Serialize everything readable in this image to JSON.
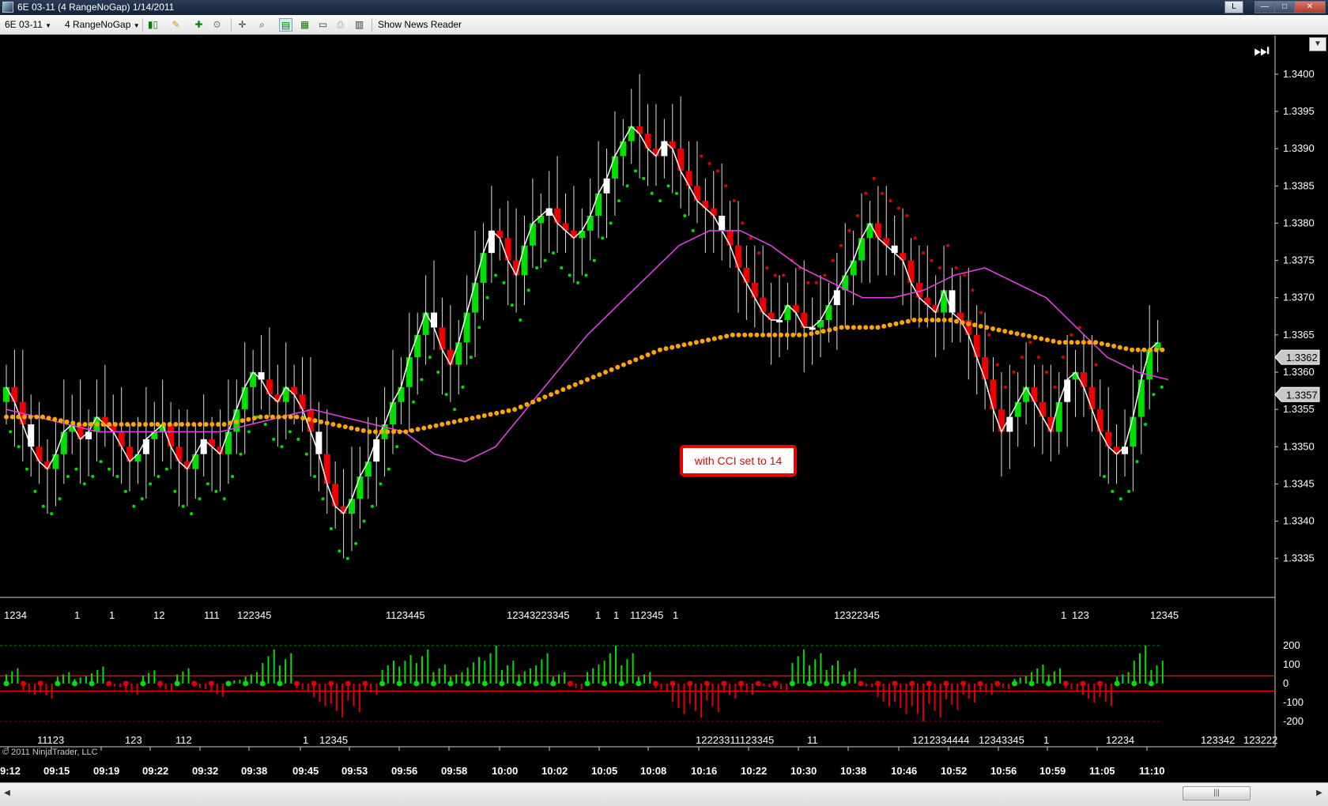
{
  "window": {
    "title": "6E 03-11 (4 RangeNoGap)  1/14/2011",
    "buttons": {
      "l": "L",
      "minimize": "—",
      "maximize": "□",
      "close": "✕"
    }
  },
  "toolbar": {
    "instrument": "6E 03-11",
    "period": "4 RangeNoGap",
    "show_news_reader": "Show News Reader",
    "icons": [
      "bar-type-icon",
      "pencil-draw-icon",
      "add-indicator-icon",
      "strategy-icon",
      "crosshair-icon",
      "zoom-icon",
      "chart-style-icon",
      "properties-icon",
      "data-box-icon",
      "print-icon",
      "instrument-icon"
    ]
  },
  "chart": {
    "annotation": "with CCI set to 14",
    "copyright": "© 2011 NinjaTrader, LLC",
    "current_price_label": "1.3362",
    "secondary_price_label": "1.3357",
    "price_axis": [
      "1.3400",
      "1.3395",
      "1.3390",
      "1.3385",
      "1.3380",
      "1.3375",
      "1.3370",
      "1.3365",
      "1.3360",
      "1.3355",
      "1.3350",
      "1.3345",
      "1.3340",
      "1.3335"
    ],
    "cci_axis": [
      "200",
      "100",
      "0",
      "-100",
      "-200"
    ],
    "time_axis": [
      "9:12",
      "09:15",
      "09:19",
      "09:22",
      "09:32",
      "09:38",
      "09:45",
      "09:53",
      "09:56",
      "09:58",
      "10:00",
      "10:02",
      "10:05",
      "10:08",
      "10:16",
      "10:22",
      "10:30",
      "10:38",
      "10:46",
      "10:52",
      "10:56",
      "10:59",
      "11:05",
      "11:10"
    ],
    "top_count_labels": [
      "1234",
      "1",
      "1",
      "12",
      "111",
      "122345",
      "1123445",
      "12343223345",
      "1",
      "1",
      "112345",
      "1",
      "12322345",
      "1",
      "123",
      "12345"
    ],
    "bottom_count_labels": [
      "11123",
      "123",
      "112",
      "1",
      "12345",
      "12223311123345",
      "11",
      "1212334444",
      "12343345",
      "1",
      "12234",
      "123342",
      "123222"
    ],
    "colors": {
      "up": "#00e000",
      "down": "#ee0000",
      "neutral": "#ffffff",
      "sma": "#e040e0",
      "ema": "#ffa500",
      "price_line": "#ffffff",
      "grid_line": "#ff0000"
    }
  },
  "chart_data": {
    "type": "candlestick",
    "title": "",
    "instrument": "6E 03-11",
    "bar_type": "4 RangeNoGap",
    "ylim": [
      1.3332,
      1.3402
    ],
    "cci_ylim": [
      -250,
      250
    ],
    "close_series": [
      1.3358,
      1.3356,
      1.3353,
      1.335,
      1.3348,
      1.3347,
      1.3349,
      1.3352,
      1.3353,
      1.3351,
      1.3352,
      1.3354,
      1.3353,
      1.3352,
      1.335,
      1.3348,
      1.3349,
      1.3351,
      1.3352,
      1.3353,
      1.335,
      1.3348,
      1.3347,
      1.3349,
      1.3351,
      1.335,
      1.3349,
      1.3352,
      1.3355,
      1.3358,
      1.336,
      1.3359,
      1.3357,
      1.3356,
      1.3358,
      1.3357,
      1.3355,
      1.3352,
      1.3349,
      1.3345,
      1.3342,
      1.3341,
      1.3343,
      1.3346,
      1.3348,
      1.3351,
      1.3353,
      1.3356,
      1.3358,
      1.3362,
      1.3365,
      1.3368,
      1.3366,
      1.3363,
      1.3361,
      1.3364,
      1.3368,
      1.3372,
      1.3376,
      1.3379,
      1.3378,
      1.3375,
      1.3373,
      1.3377,
      1.338,
      1.3381,
      1.3382,
      1.338,
      1.3379,
      1.3378,
      1.3379,
      1.3381,
      1.3384,
      1.3386,
      1.3389,
      1.3391,
      1.3393,
      1.3392,
      1.339,
      1.3389,
      1.3391,
      1.339,
      1.3387,
      1.3385,
      1.3383,
      1.3382,
      1.3381,
      1.3379,
      1.3377,
      1.3374,
      1.3372,
      1.337,
      1.3368,
      1.3367,
      1.3367,
      1.3369,
      1.3368,
      1.3366,
      1.3366,
      1.3367,
      1.3369,
      1.3371,
      1.3373,
      1.3375,
      1.3378,
      1.338,
      1.3378,
      1.3377,
      1.3376,
      1.3375,
      1.3372,
      1.337,
      1.3369,
      1.3368,
      1.3371,
      1.3368,
      1.3367,
      1.3365,
      1.3362,
      1.3359,
      1.3355,
      1.3352,
      1.3354,
      1.3356,
      1.3358,
      1.3356,
      1.3354,
      1.3352,
      1.3356,
      1.3359,
      1.336,
      1.3358,
      1.3355,
      1.3352,
      1.335,
      1.3349,
      1.335,
      1.3354,
      1.3359,
      1.3363,
      1.3364
    ],
    "sma_series": [
      1.3355,
      1.3354,
      1.3353,
      1.3352,
      1.3352,
      1.3352,
      1.3352,
      1.3352,
      1.3353,
      1.3354,
      1.3355,
      1.3354,
      1.3353,
      1.3352,
      1.3349,
      1.3348,
      1.335,
      1.3355,
      1.336,
      1.3365,
      1.3369,
      1.3373,
      1.3377,
      1.3379,
      1.3379,
      1.3377,
      1.3374,
      1.3372,
      1.337,
      1.337,
      1.3371,
      1.3373,
      1.3374,
      1.3372,
      1.337,
      1.3366,
      1.3362,
      1.336,
      1.3359
    ],
    "ema_series": [
      1.3354,
      1.3354,
      1.3353,
      1.3353,
      1.3353,
      1.3353,
      1.3353,
      1.3354,
      1.3354,
      1.3353,
      1.3352,
      1.3352,
      1.3353,
      1.3354,
      1.3355,
      1.3357,
      1.3359,
      1.3361,
      1.3363,
      1.3364,
      1.3365,
      1.3365,
      1.3365,
      1.3366,
      1.3366,
      1.3367,
      1.3367,
      1.3366,
      1.3365,
      1.3364,
      1.3364,
      1.3363,
      1.3363
    ],
    "cci_values": [
      80,
      -60,
      -80,
      60,
      40,
      90,
      -20,
      -60,
      70,
      -40,
      80,
      -30,
      -70,
      20,
      60,
      180,
      160,
      -40,
      -120,
      -180,
      -150,
      -60,
      120,
      150,
      180,
      100,
      60,
      140,
      200,
      120,
      80,
      160,
      60,
      -30,
      100,
      200,
      160,
      60,
      -40,
      -160,
      -180,
      -150,
      -80,
      -60,
      -20,
      -40,
      180,
      160,
      120,
      80,
      -20,
      -120,
      -160,
      -200,
      -180,
      -140,
      -100,
      -60,
      -30,
      40,
      100,
      80,
      -40,
      -100,
      -120,
      60,
      200,
      120
    ]
  }
}
